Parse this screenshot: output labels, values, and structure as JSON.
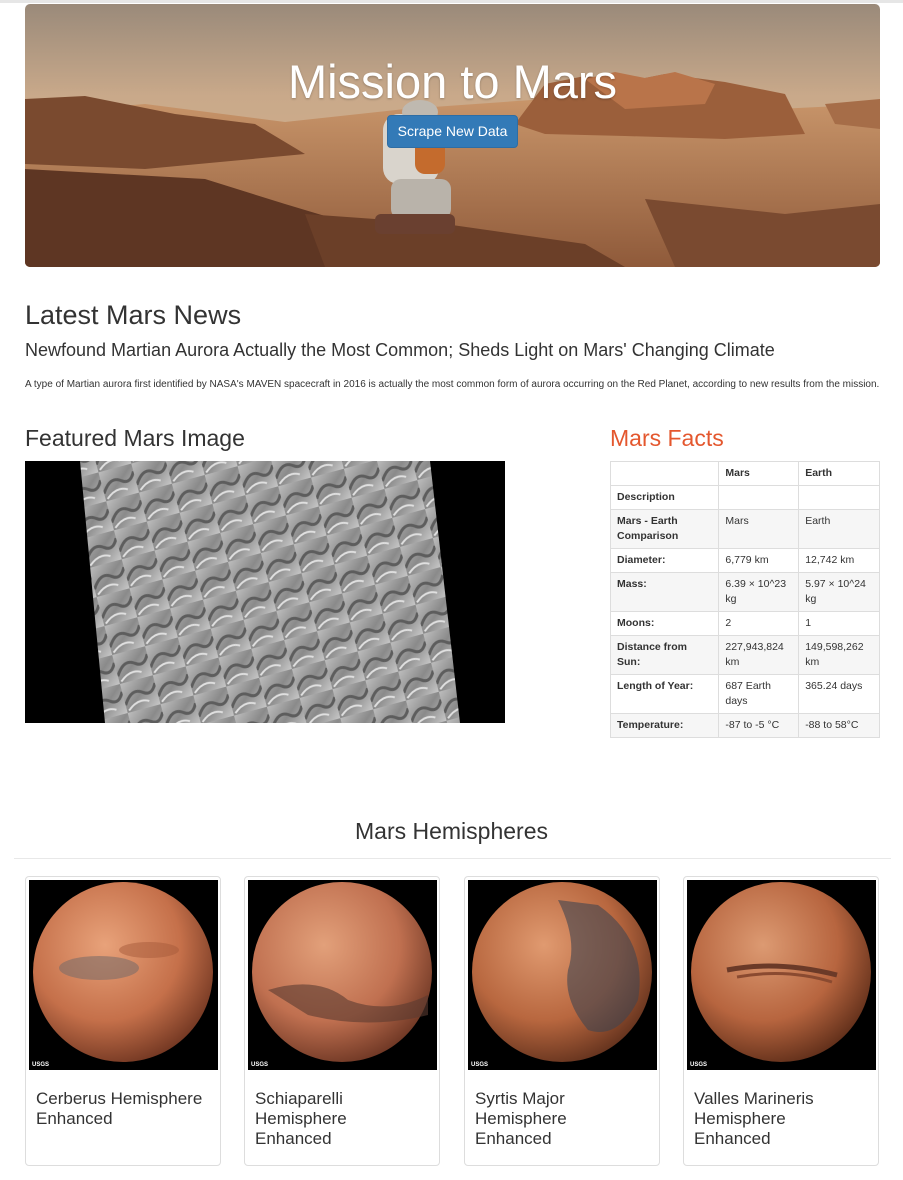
{
  "header": {
    "title": "Mission to Mars",
    "scrape_button": "Scrape New Data"
  },
  "news": {
    "heading": "Latest Mars News",
    "title": "Newfound Martian Aurora Actually the Most Common; Sheds Light on Mars' Changing Climate",
    "paragraph": "A type of Martian aurora first identified by NASA's MAVEN spacecraft in 2016 is actually the most common form of aurora occurring on the Red Planet, according to new results from the mission."
  },
  "featured": {
    "heading": "Featured Mars Image"
  },
  "facts": {
    "heading": "Mars Facts",
    "columns": [
      "",
      "Mars",
      "Earth"
    ],
    "rows": [
      {
        "label": "Description",
        "mars": "",
        "earth": ""
      },
      {
        "label": "Mars - Earth Comparison",
        "mars": "Mars",
        "earth": "Earth"
      },
      {
        "label": "Diameter:",
        "mars": "6,779 km",
        "earth": "12,742 km"
      },
      {
        "label": "Mass:",
        "mars": "6.39 × 10^23 kg",
        "earth": "5.97 × 10^24 kg"
      },
      {
        "label": "Moons:",
        "mars": "2",
        "earth": "1"
      },
      {
        "label": "Distance from Sun:",
        "mars": "227,943,824 km",
        "earth": "149,598,262 km"
      },
      {
        "label": "Length of Year:",
        "mars": "687 Earth days",
        "earth": "365.24 days"
      },
      {
        "label": "Temperature:",
        "mars": "-87 to -5 °C",
        "earth": "-88 to 58°C"
      }
    ]
  },
  "hemispheres": {
    "heading": "Mars Hemispheres",
    "logo_text": "USGS",
    "items": [
      {
        "title": "Cerberus Hemisphere Enhanced"
      },
      {
        "title": "Schiaparelli Hemisphere Enhanced"
      },
      {
        "title": "Syrtis Major Hemisphere Enhanced"
      },
      {
        "title": "Valles Marineris Hemisphere Enhanced"
      }
    ]
  },
  "colors": {
    "accent_blue": "#337ab7",
    "facts_heading": "#e4572e"
  }
}
